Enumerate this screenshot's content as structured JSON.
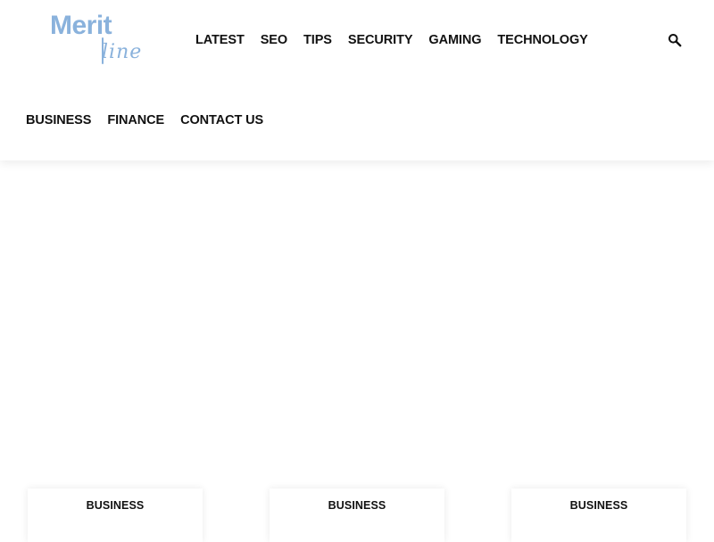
{
  "header": {
    "logo": {
      "main_text": "Merit",
      "sub_text": "line",
      "color": "#8ab2dc"
    },
    "nav_primary": [
      {
        "label": "LATEST"
      },
      {
        "label": "SEO"
      },
      {
        "label": "TIPS"
      },
      {
        "label": "SECURITY"
      },
      {
        "label": "GAMING"
      },
      {
        "label": "TECHNOLOGY"
      }
    ],
    "nav_secondary": [
      {
        "label": "BUSINESS"
      },
      {
        "label": "FINANCE"
      },
      {
        "label": "CONTACT US"
      }
    ],
    "search_icon": "search-icon"
  },
  "cards": [
    {
      "category": "BUSINESS"
    },
    {
      "category": "BUSINESS"
    },
    {
      "category": "BUSINESS"
    }
  ],
  "colors": {
    "text": "#111111",
    "background": "#ffffff"
  }
}
